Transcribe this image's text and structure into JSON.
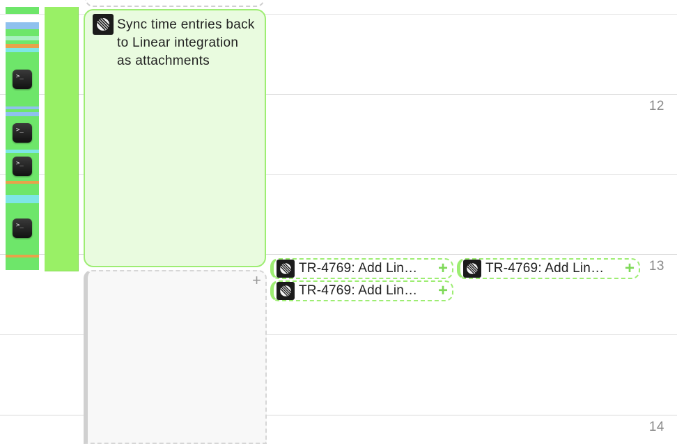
{
  "hour_labels": [
    "12",
    "13",
    "14"
  ],
  "event": {
    "title": "Sync time entries back to Linear integration as attachments",
    "icon": "linear-icon",
    "accent_color": "#9ded72",
    "fill_color": "#e9fbdf"
  },
  "empty_block": {
    "plus_symbol": "+"
  },
  "chips": [
    {
      "label": "TR-4769: Add Lin…",
      "plus": "+"
    },
    {
      "label": "TR-4769: Add Lin…",
      "plus": "+"
    },
    {
      "label": "TR-4769: Add Lin…",
      "plus": "+"
    }
  ],
  "activity_icons": [
    "terminal-icon",
    "terminal-icon",
    "terminal-icon",
    "terminal-icon"
  ],
  "terminal_prompt": ">_",
  "colors": {
    "tracked": "#99f066",
    "activity_green": "#6ee66a",
    "activity_blue": "#8fc1ee",
    "activity_orange": "#e8a24a",
    "activity_cyan": "#7ee6e6"
  }
}
